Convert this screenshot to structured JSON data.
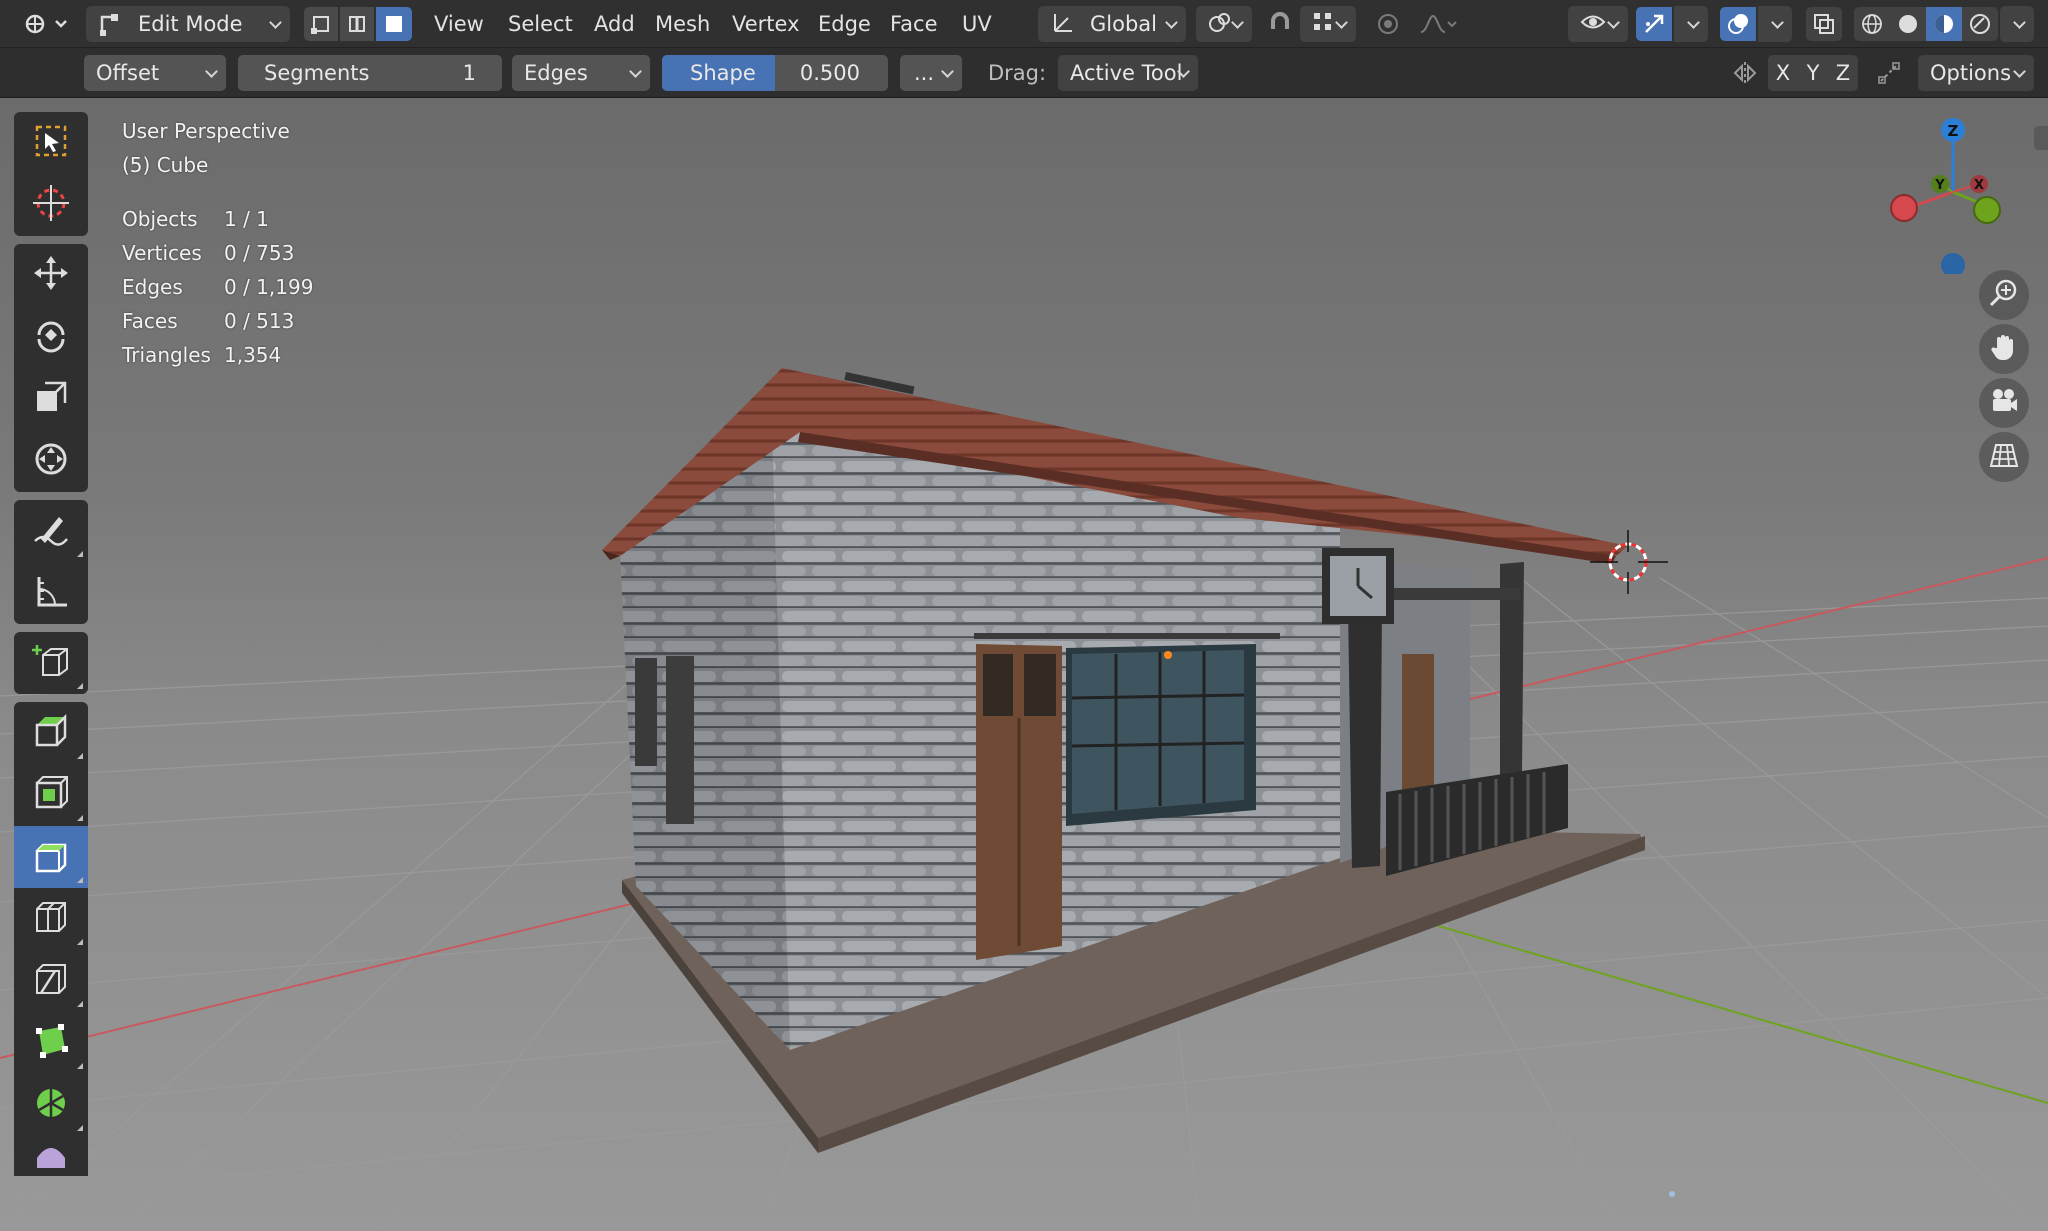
{
  "header": {
    "mode_label": "Edit Mode",
    "menus": [
      "View",
      "Select",
      "Add",
      "Mesh",
      "Vertex",
      "Edge",
      "Face",
      "UV"
    ],
    "transform_orientation": "Global"
  },
  "tool_settings": {
    "affect": "Offset",
    "segments_label": "Segments",
    "segments_value": "1",
    "affect_mode": "Edges",
    "shape_label": "Shape",
    "shape_value": "0.500",
    "more": "...",
    "drag_label": "Drag:",
    "drag_value": "Active Tool",
    "axis": [
      "X",
      "Y",
      "Z"
    ],
    "options": "Options"
  },
  "viewport": {
    "view_name": "User Perspective",
    "object_name": "(5) Cube",
    "stats": [
      {
        "label": "Objects",
        "value": "1 / 1"
      },
      {
        "label": "Vertices",
        "value": "0 / 753"
      },
      {
        "label": "Edges",
        "value": "0 / 1,199"
      },
      {
        "label": "Faces",
        "value": "0 / 513"
      },
      {
        "label": "Triangles",
        "value": "1,354"
      }
    ],
    "gizmo": {
      "z_label": "Z",
      "y_label": "Y",
      "x_label": "X"
    }
  },
  "tools": [
    "select-box-icon",
    "cursor-icon",
    "move-icon",
    "rotate-icon",
    "scale-icon",
    "transform-icon",
    "annotate-icon",
    "measure-icon",
    "add-cube-icon",
    "extrude-icon",
    "inset-icon",
    "bevel-icon",
    "loop-cut-icon",
    "knife-icon",
    "poly-build-icon",
    "spin-icon",
    "smooth-icon"
  ],
  "colors": {
    "accent": "#4772b3",
    "x_axis": "#d5484e",
    "y_axis": "#6ea31e",
    "z_axis": "#2c7fd6"
  }
}
